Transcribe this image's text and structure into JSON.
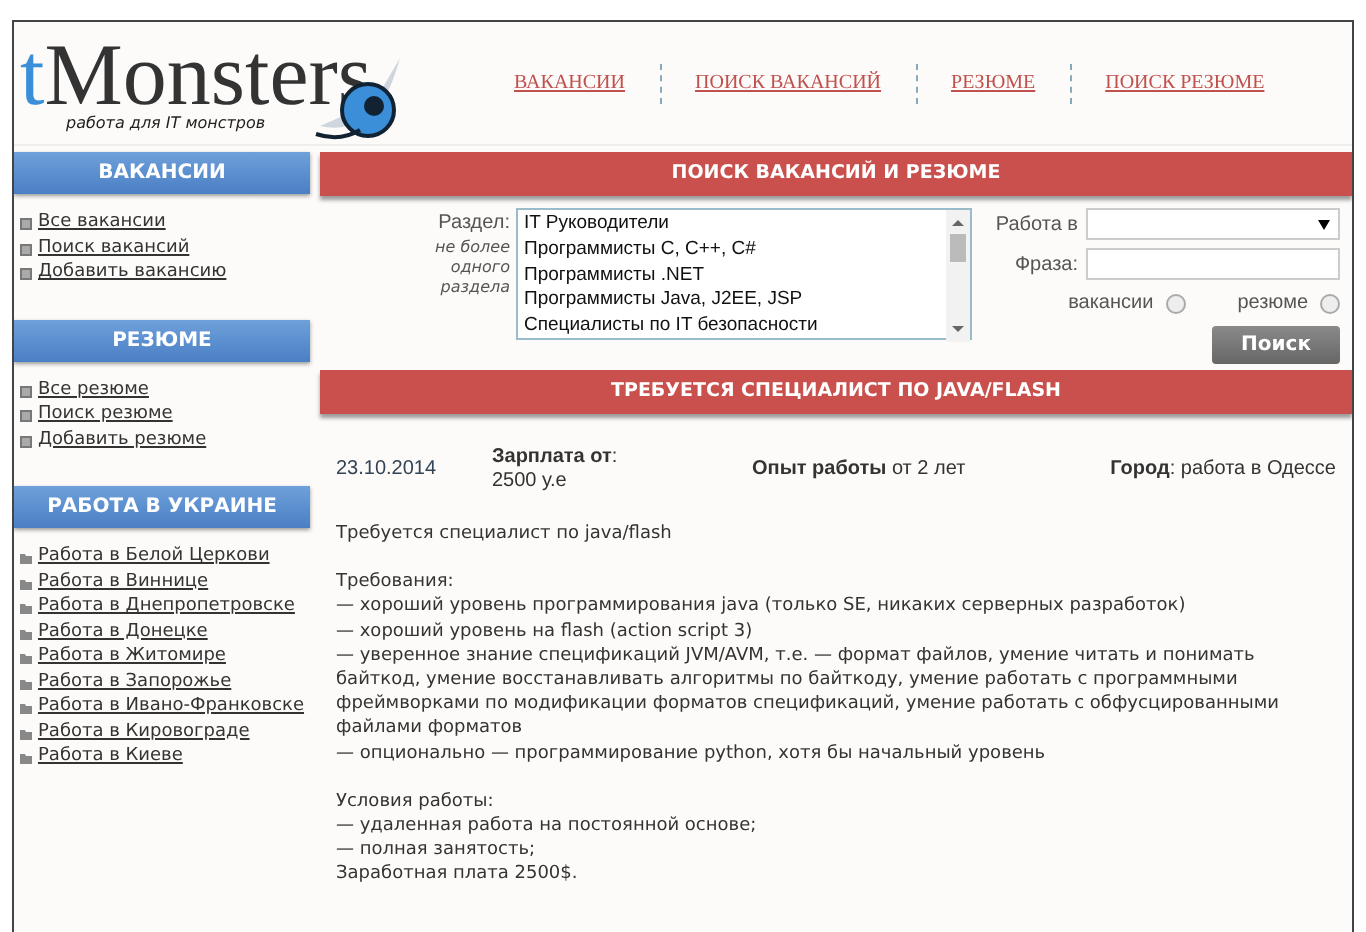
{
  "logo": {
    "accent": "t",
    "text": "Monsters",
    "tagline": "работа для IT монстров"
  },
  "top_nav": [
    "ВАКАНСИИ",
    "ПОИСК ВАКАНСИЙ",
    "РЕЗЮМЕ",
    "ПОИСК РЕЗЮМЕ"
  ],
  "sidebar": [
    {
      "title": "ВАКАНСИИ",
      "kind": "square",
      "items": [
        "Все вакансии",
        "Поиск вакансий",
        "Добавить вакансию"
      ]
    },
    {
      "title": "РЕЗЮМЕ",
      "kind": "square",
      "items": [
        "Все резюме",
        "Поиск резюме",
        "Добавить резюме"
      ]
    },
    {
      "title": "РАБОТА В УКРАИНЕ",
      "kind": "folder",
      "items": [
        "Работа в Белой Церкови",
        "Работа в Виннице",
        "Работа в Днепропетровске",
        "Работа в Донецке",
        "Работа в Житомире",
        "Работа в Запорожье",
        "Работа в Ивано-Франковске",
        "Работа в Кировограде",
        "Работа в Киеве"
      ]
    }
  ],
  "search": {
    "title": "ПОИСК ВАКАНСИЙ И РЕЗЮМЕ",
    "section_label": "Раздел:",
    "section_hint": "не более одного раздела",
    "sections": [
      "IT Руководители",
      "Программисты C, C++, C#",
      "Программисты .NET",
      "Программисты Java, J2EE, JSP",
      "Специалисты по IT безопасности"
    ],
    "city_label": "Работа в",
    "phrase_label": "Фраза:",
    "types": [
      {
        "label": "вакансии",
        "selected": false
      },
      {
        "label": "резюме",
        "selected": false
      }
    ],
    "button": "Поиск"
  },
  "job": {
    "title": "ТРЕБУЕТСЯ СПЕЦИАЛИСТ ПО JAVA/FLASH",
    "date": "23.10.2014",
    "salary": "**Зарплата от**: 2500 у.е",
    "experience": "**Опыт работы** от 2 лет",
    "city": "**Город**: работа в Одессе",
    "paragraphs": [
      [
        "Требуется специалист по java/flash"
      ],
      [
        "Требования:",
        "— хороший уровень программирования java (только SE, никаких серверных разработок)",
        "— хороший уровень на flash (action script 3)",
        "— уверенное знание спецификаций JVM/AVM, т.е. — формат файлов, умение читать и понимать байткод, умение восстанавливать алгоритмы по байткоду, умение работать с программными фреймворками по модификации форматов спецификаций, умение работать с обфусцированными файлами форматов",
        "— опционально — программирование python, хотя бы начальный уровень"
      ],
      [
        "Условия работы:",
        "— удаленная работа на постоянной основе;",
        "— полная занятость;",
        "Заработная плата 2500$."
      ]
    ]
  }
}
